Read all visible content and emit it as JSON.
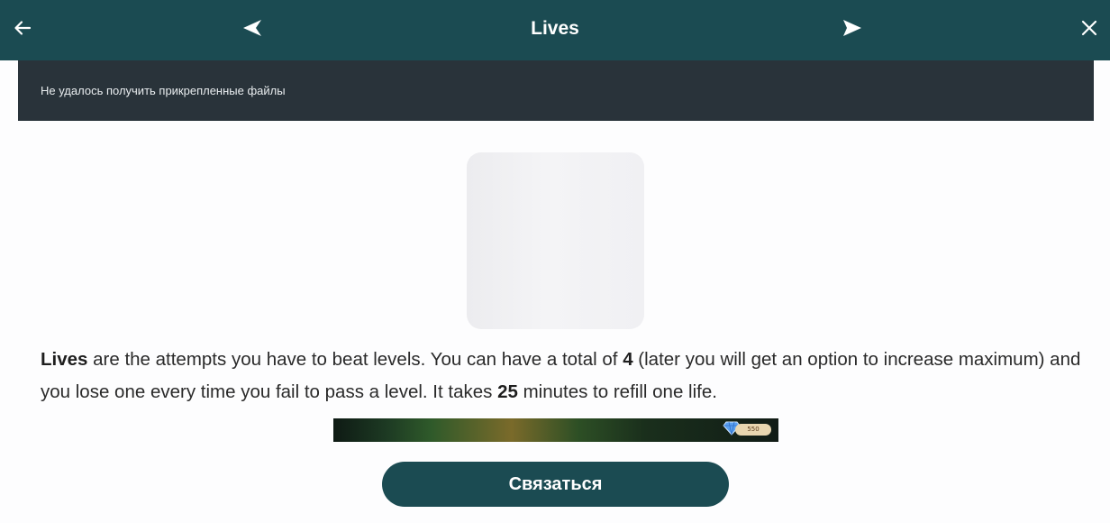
{
  "header": {
    "title": "Lives",
    "back_icon": "arrow-left-icon",
    "prev_icon": "triangle-left-icon",
    "next_icon": "send-arrow-icon",
    "close_icon": "close-icon"
  },
  "error_banner": {
    "text": "Не удалось получить прикрепленные файлы"
  },
  "article": {
    "image": "image-placeholder",
    "p1_bold": "Lives",
    "p1_a": " are the attempts you have to beat levels. You can have a total of ",
    "p1_count": "4",
    "p1_b": " (later you will get an option to increase maximum) and you lose one every time you fail to pass a level. It takes ",
    "p1_minutes": "25",
    "p1_c": " minutes to refill one life.",
    "game_strip": {
      "gem_icon": "diamond-icon",
      "gem_count": "550"
    }
  },
  "footer": {
    "contact_label": "Связаться"
  },
  "colors": {
    "header_bg": "#1b4b52",
    "banner_bg": "#29333a",
    "button_bg": "#1b4b52",
    "page_bg": "#fdfdfe"
  }
}
